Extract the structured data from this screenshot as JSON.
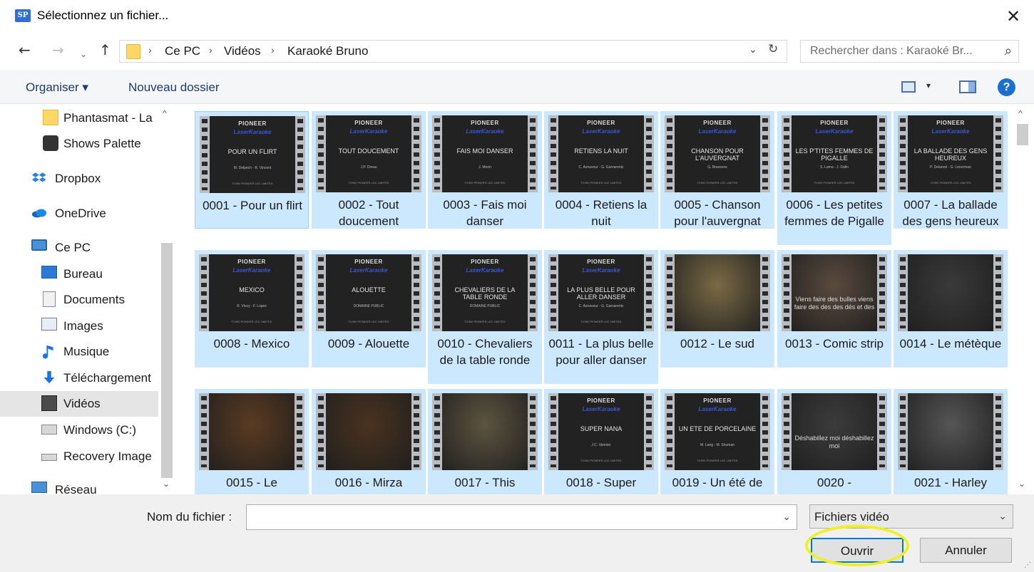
{
  "window": {
    "app_icon": "SP",
    "title": "Sélectionnez un fichier...",
    "close": "✕"
  },
  "nav": {
    "back": "←",
    "forward": "→",
    "recent": "⌄",
    "up": "↑",
    "breadcrumbs": [
      "Ce PC",
      "Vidéos",
      "Karaoké Bruno"
    ],
    "separator": "›",
    "dropdown": "⌄",
    "refresh": "↻",
    "search_placeholder": "Rechercher dans : Karaoké Br...",
    "search_icon": "⚲"
  },
  "toolbar": {
    "organise": "Organiser ▾",
    "new_folder": "Nouveau dossier",
    "view_dropdown": "▾",
    "help": "?"
  },
  "sidebar": {
    "items": [
      {
        "label": "Phantasmat - La",
        "icon": "folder-icon"
      },
      {
        "label": "Shows Palette",
        "icon": "palette-icon"
      },
      {
        "label": "Dropbox",
        "icon": "dropbox-icon"
      },
      {
        "label": "OneDrive",
        "icon": "onedrive-icon"
      },
      {
        "label": "Ce PC",
        "icon": "pc-icon"
      },
      {
        "label": "Bureau",
        "icon": "desktop-icon"
      },
      {
        "label": "Documents",
        "icon": "documents-icon"
      },
      {
        "label": "Images",
        "icon": "images-icon"
      },
      {
        "label": "Musique",
        "icon": "music-icon"
      },
      {
        "label": "Téléchargement",
        "icon": "download-icon"
      },
      {
        "label": "Vidéos",
        "icon": "videos-icon"
      },
      {
        "label": "Windows (C:)",
        "icon": "drive-icon"
      },
      {
        "label": "Recovery Image",
        "icon": "drive-icon"
      },
      {
        "label": "Réseau",
        "icon": "network-icon"
      }
    ],
    "scroll_up": "^",
    "scroll_down": "⌄"
  },
  "files": [
    {
      "label": "0001 - Pour un flirt",
      "thumb": "karaoke",
      "song": "POUR UN FLIRT",
      "authors": "M. Delpech - R. Vincent"
    },
    {
      "label": "0002 - Tout doucement",
      "thumb": "karaoke",
      "song": "TOUT DOUCEMENT",
      "authors": "J.P. Dreau"
    },
    {
      "label": "0003 - Fais moi danser",
      "thumb": "karaoke",
      "song": "FAIS MOI DANSER",
      "authors": "J. Morin"
    },
    {
      "label": "0004 - Retiens la nuit",
      "thumb": "karaoke",
      "song": "RETIENS LA NUIT",
      "authors": "C. Aznavour - G. Garvarentz"
    },
    {
      "label": "0005 - Chanson pour l'auvergnat",
      "thumb": "karaoke",
      "song": "CHANSON POUR L'AUVERGNAT",
      "authors": "G. Brassens"
    },
    {
      "label": "0006 - Les petites femmes de Pigalle",
      "thumb": "karaoke",
      "song": "LES P'TITES FEMMES DE PIGALLE",
      "authors": "S. Lama - J. Dafin"
    },
    {
      "label": "0007 - La ballade des gens heureux",
      "thumb": "karaoke",
      "song": "LA BALLADE DES GENS HEUREUX",
      "authors": "P. Delanoë - G. Lenorman"
    },
    {
      "label": "0008 - Mexico",
      "thumb": "karaoke",
      "song": "MEXICO",
      "authors": "R. Vincy - F. Lopez"
    },
    {
      "label": "0009 - Alouette",
      "thumb": "karaoke",
      "song": "ALOUETTE",
      "authors": "DOMAINE PUBLIC"
    },
    {
      "label": "0010 - Chevaliers de la table ronde",
      "thumb": "karaoke",
      "song": "CHEVALIERS DE LA TABLE RONDE",
      "authors": "DOMAINE PUBLIC"
    },
    {
      "label": "0011 - La plus belle pour aller danser",
      "thumb": "karaoke",
      "song": "LA PLUS BELLE POUR ALLER DANSER",
      "authors": "C. Aznavour - G. Garvarentz"
    },
    {
      "label": "0012 - Le sud",
      "thumb": "photo",
      "color": "#7a6a45"
    },
    {
      "label": "0013 - Comic strip",
      "thumb": "photo",
      "color": "#5a4a3e",
      "caption": "Viens faire des bulles viens faire des des des dés et des"
    },
    {
      "label": "0014 - Le métèque",
      "thumb": "photo",
      "color": "#3a3a3a"
    },
    {
      "label": "0015 - Le",
      "thumb": "photo",
      "color": "#5b3b22"
    },
    {
      "label": "0016 - Mirza",
      "thumb": "photo",
      "color": "#4a3320"
    },
    {
      "label": "0017 - This",
      "thumb": "photo",
      "color": "#5d5440"
    },
    {
      "label": "0018 - Super",
      "thumb": "karaoke",
      "song": "SUPER NANA",
      "authors": "J.C. Vannier"
    },
    {
      "label": "0019 - Un été de",
      "thumb": "karaoke",
      "song": "UN ETE DE PORCELAINE",
      "authors": "M. Lang - M. Shuman"
    },
    {
      "label": "0020 -",
      "thumb": "photo",
      "color": "#3c3c3c",
      "caption": "Déshabillez moi déshabillez moi"
    },
    {
      "label": "0021 - Harley",
      "thumb": "photo",
      "color": "#555555"
    }
  ],
  "karaoke_logo": {
    "brand": "PIONEER",
    "product": "LaserKaraoke",
    "copyright": "©1992 PIONEER LDC LIMITED"
  },
  "footer": {
    "filename_label": "Nom du fichier :",
    "filename_value": "",
    "filename_dropdown": "⌄",
    "filetype_value": "Fichiers vidéo",
    "filetype_dropdown": "⌄",
    "open_label": "Ouvrir",
    "cancel_label": "Annuler"
  }
}
